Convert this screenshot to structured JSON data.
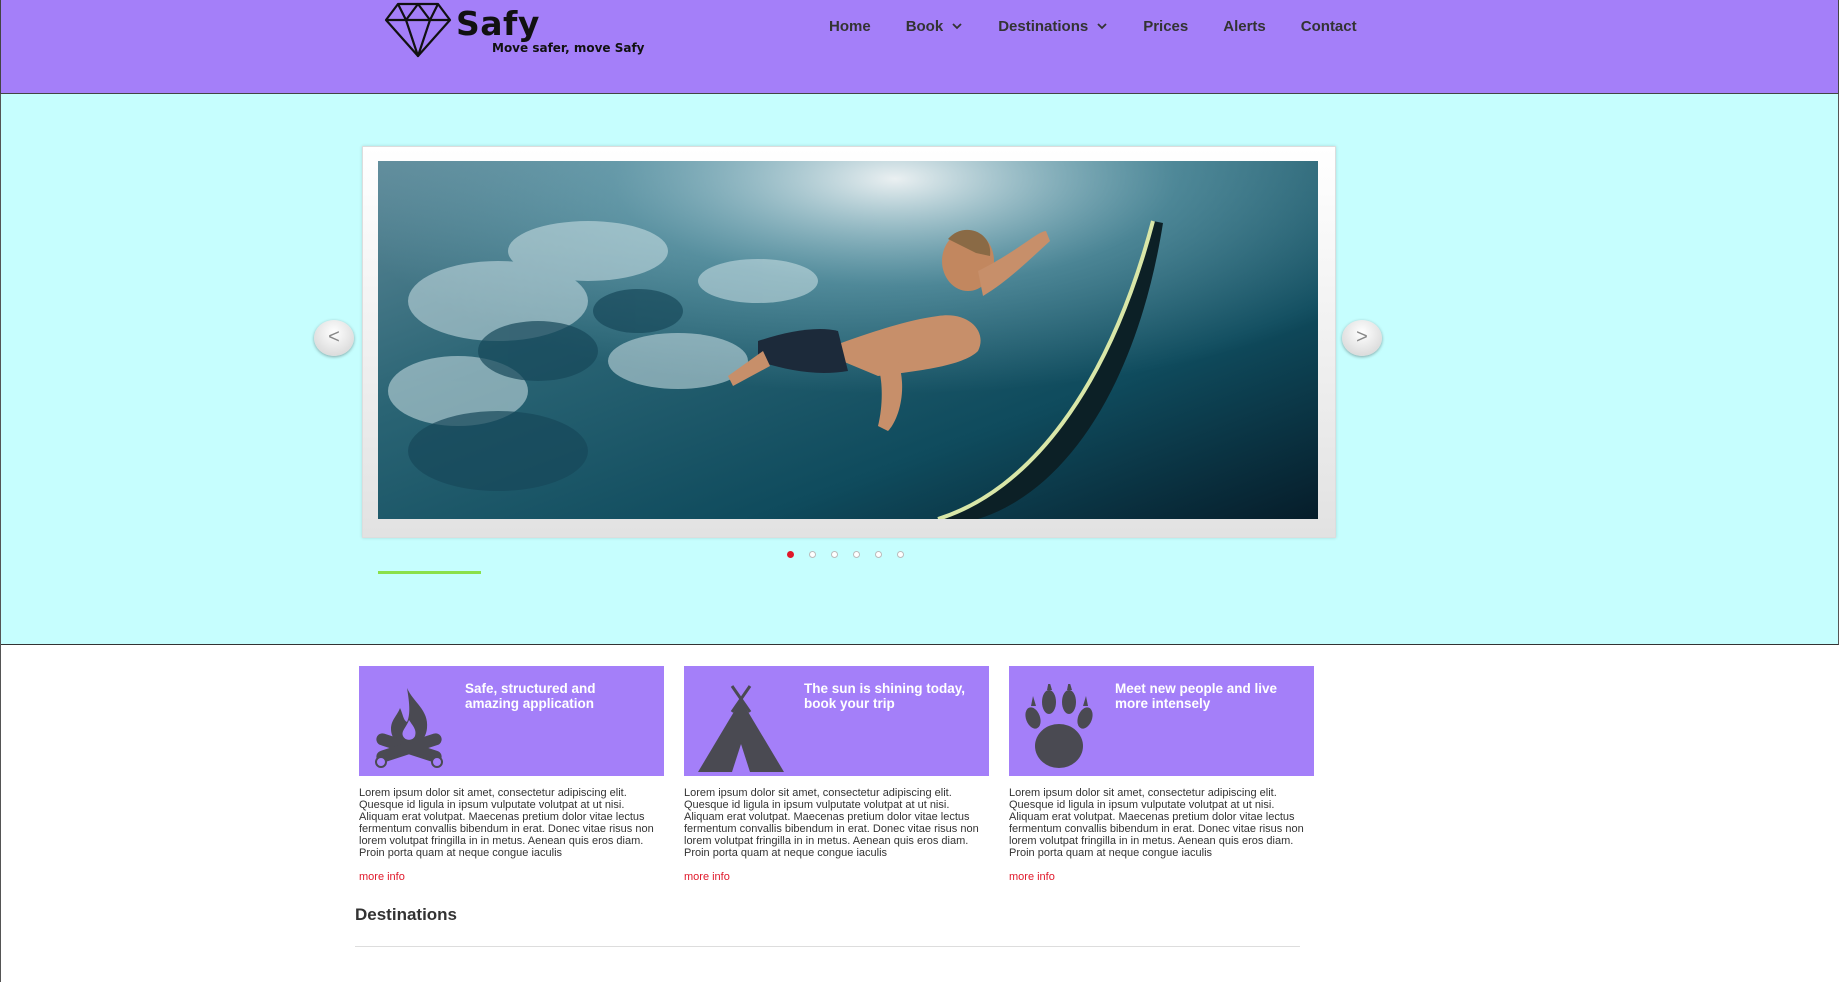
{
  "brand": {
    "name": "Safy",
    "tagline": "Move safer, move Safy"
  },
  "nav": {
    "items": [
      {
        "label": "Home",
        "dropdown": false
      },
      {
        "label": "Book",
        "dropdown": true
      },
      {
        "label": "Destinations",
        "dropdown": true
      },
      {
        "label": "Prices",
        "dropdown": false
      },
      {
        "label": "Alerts",
        "dropdown": false
      },
      {
        "label": "Contact",
        "dropdown": false
      }
    ]
  },
  "slider": {
    "prev_label": "<",
    "next_label": ">",
    "slide_count": 6,
    "active_index": 0,
    "progress": 0.11
  },
  "features": [
    {
      "title": "Safe, structured and amazing application",
      "icon": "campfire-icon",
      "text": "Lorem ipsum dolor sit amet, consectetur adipiscing elit. Quesque id ligula in ipsum vulputate volutpat at ut nisi. Aliquam erat volutpat. Maecenas pretium dolor vitae lectus fermentum convallis bibendum in erat. Donec vitae risus non lorem volutpat fringilla in in metus. Aenean quis eros diam. Proin porta quam at neque congue iaculis",
      "link": "more info"
    },
    {
      "title": "The sun is shining today, book your trip",
      "icon": "tent-icon",
      "text": "Lorem ipsum dolor sit amet, consectetur adipiscing elit. Quesque id ligula in ipsum vulputate volutpat at ut nisi. Aliquam erat volutpat. Maecenas pretium dolor vitae lectus fermentum convallis bibendum in erat. Donec vitae risus non lorem volutpat fringilla in in metus. Aenean quis eros diam. Proin porta quam at neque congue iaculis",
      "link": "more info"
    },
    {
      "title": "Meet new people and live more intensely",
      "icon": "paw-icon",
      "text": "Lorem ipsum dolor sit amet, consectetur adipiscing elit. Quesque id ligula in ipsum vulputate volutpat at ut nisi. Aliquam erat volutpat. Maecenas pretium dolor vitae lectus fermentum convallis bibendum in erat. Donec vitae risus non lorem volutpat fringilla in in metus. Aenean quis eros diam. Proin porta quam at neque congue iaculis",
      "link": "more info"
    }
  ],
  "destinations": {
    "title": "Destinations"
  },
  "colors": {
    "header": "#a47ff9",
    "hero": "#c6fefe",
    "accent": "#e0182a",
    "feature_box": "#a47ff9"
  }
}
